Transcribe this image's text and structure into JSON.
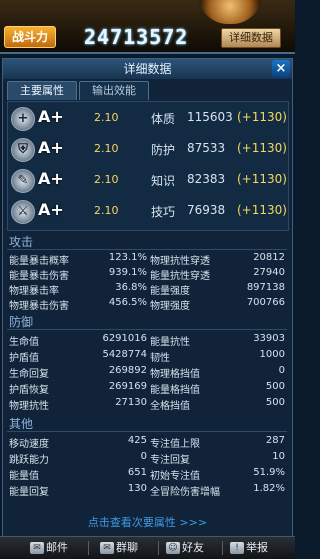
{
  "top": {
    "power_label": "战斗力",
    "power_value": "24713572",
    "detail_button": "详细数据"
  },
  "panel": {
    "title": "详细数据",
    "close": "×",
    "tabs": [
      "主要属性",
      "输出效能"
    ]
  },
  "main_attributes": [
    {
      "icon": "plus-shield-icon",
      "glyph": "+",
      "grade": "A+",
      "level": "2.10",
      "name": "体质",
      "value": "115603",
      "bonus": "(+1130)"
    },
    {
      "icon": "shield-icon",
      "glyph": "⛨",
      "grade": "A+",
      "level": "2.10",
      "name": "防护",
      "value": "87533",
      "bonus": "(+1130)"
    },
    {
      "icon": "knowledge-icon",
      "glyph": "✎",
      "grade": "A+",
      "level": "2.10",
      "name": "知识",
      "value": "82383",
      "bonus": "(+1130)"
    },
    {
      "icon": "skill-icon",
      "glyph": "⚔",
      "grade": "A+",
      "level": "2.10",
      "name": "技巧",
      "value": "76938",
      "bonus": "(+1130)"
    }
  ],
  "sections": {
    "attack": {
      "title": "攻击",
      "rows": [
        [
          {
            "label": "能量暴击概率",
            "value": "123.1%"
          },
          {
            "label": "物理抗性穿透",
            "value": "20812"
          }
        ],
        [
          {
            "label": "能量暴击伤害",
            "value": "939.1%"
          },
          {
            "label": "能量抗性穿透",
            "value": "27940"
          }
        ],
        [
          {
            "label": "物理暴击率",
            "value": "36.8%"
          },
          {
            "label": "能量强度",
            "value": "897138"
          }
        ],
        [
          {
            "label": "物理暴击伤害",
            "value": "456.5%"
          },
          {
            "label": "物理强度",
            "value": "700766"
          }
        ]
      ]
    },
    "defense": {
      "title": "防御",
      "rows": [
        [
          {
            "label": "生命值",
            "value": "6291016"
          },
          {
            "label": "能量抗性",
            "value": "33903"
          }
        ],
        [
          {
            "label": "护盾值",
            "value": "5428774"
          },
          {
            "label": "韧性",
            "value": "1000"
          }
        ],
        [
          {
            "label": "生命回复",
            "value": "269892"
          },
          {
            "label": "物理格挡值",
            "value": "0"
          }
        ],
        [
          {
            "label": "护盾恢复",
            "value": "269169"
          },
          {
            "label": "能量格挡值",
            "value": "500"
          }
        ],
        [
          {
            "label": "物理抗性",
            "value": "27130"
          },
          {
            "label": "全格挡值",
            "value": "500"
          }
        ]
      ]
    },
    "other": {
      "title": "其他",
      "rows": [
        [
          {
            "label": "移动速度",
            "value": "425"
          },
          {
            "label": "专注值上限",
            "value": "287"
          }
        ],
        [
          {
            "label": "跳跃能力",
            "value": "0"
          },
          {
            "label": "专注回复",
            "value": "10"
          }
        ],
        [
          {
            "label": "能量值",
            "value": "651"
          },
          {
            "label": "初始专注值",
            "value": "51.9%"
          }
        ],
        [
          {
            "label": "能量回复",
            "value": "130"
          },
          {
            "label": "全冒险伤害增幅",
            "value": "1.82%"
          }
        ]
      ]
    }
  },
  "more_link": "点击查看次要属性 >>>",
  "bottom_bar": [
    {
      "icon": "mail-icon",
      "label": "邮件"
    },
    {
      "icon": "chat-icon",
      "label": "群聊"
    },
    {
      "icon": "friends-icon",
      "label": "好友"
    },
    {
      "icon": "report-icon",
      "label": "举报"
    }
  ]
}
